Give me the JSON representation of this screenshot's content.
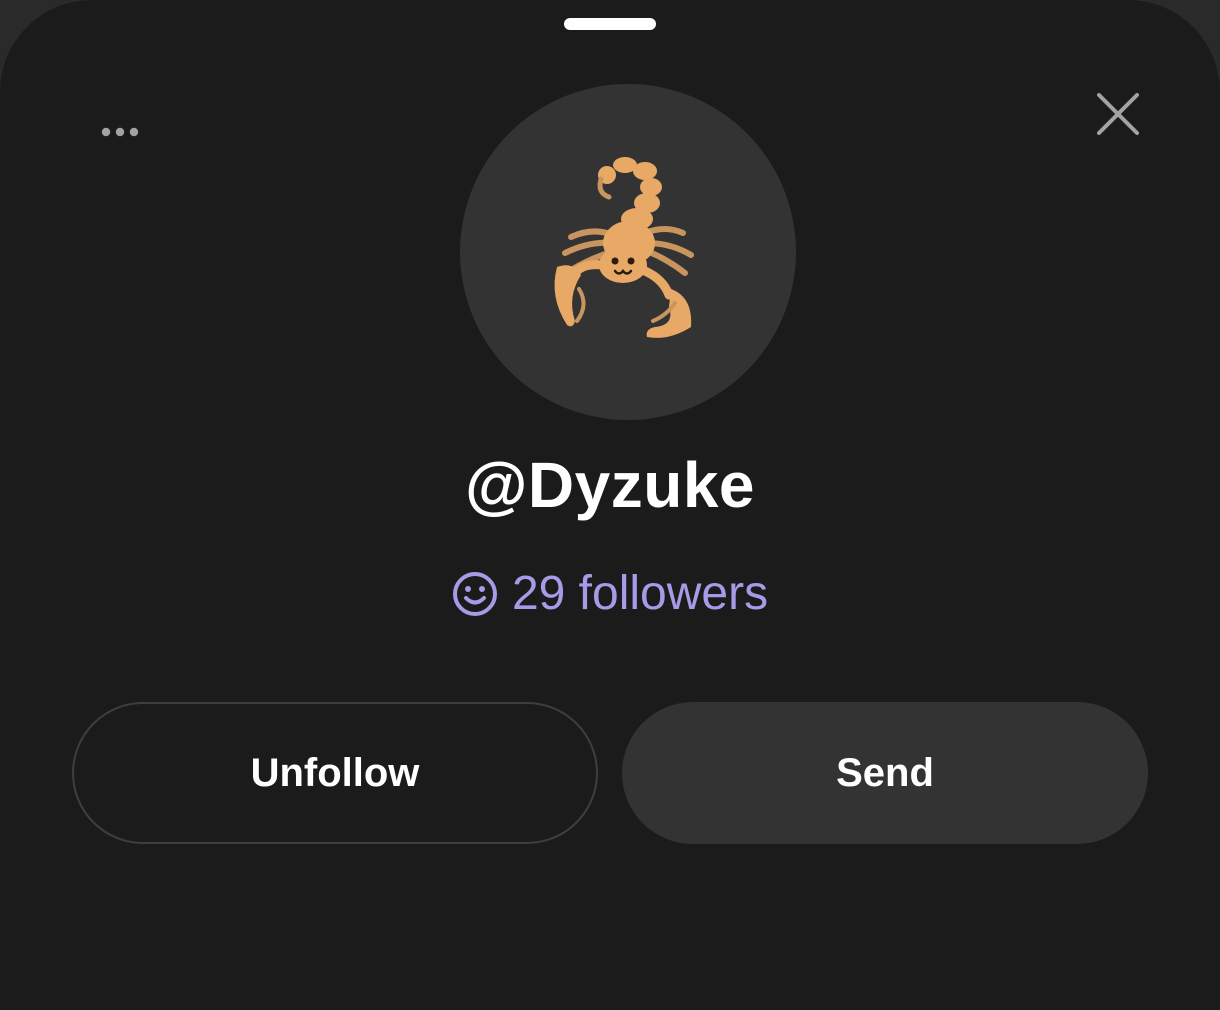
{
  "profile": {
    "username": "@Dyzuke",
    "followers_text": "29 followers",
    "avatar_emoji": "scorpion"
  },
  "actions": {
    "unfollow_label": "Unfollow",
    "send_label": "Send"
  },
  "icons": {
    "more": "more-horizontal-icon",
    "close": "close-icon",
    "followers": "smile-icon"
  },
  "colors": {
    "background": "#1b1b1b",
    "avatar_bg": "#333333",
    "accent": "#a89ae6",
    "text": "#ffffff",
    "send_bg": "#333333"
  }
}
